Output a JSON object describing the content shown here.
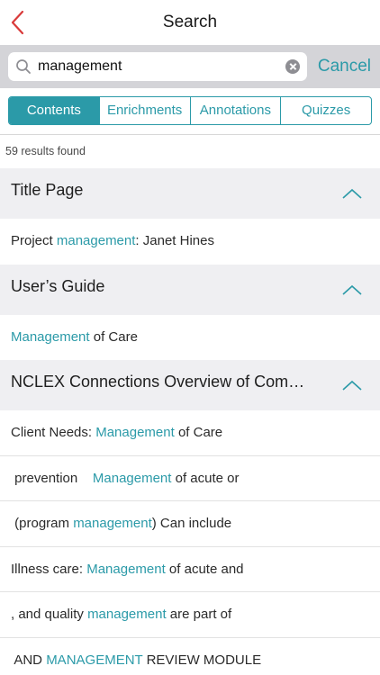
{
  "nav": {
    "title": "Search"
  },
  "search": {
    "query": "management",
    "cancel_label": "Cancel"
  },
  "tabs": [
    {
      "label": "Contents",
      "active": true
    },
    {
      "label": "Enrichments",
      "active": false
    },
    {
      "label": "Annotations",
      "active": false
    },
    {
      "label": "Quizzes",
      "active": false
    }
  ],
  "results_count": "59 results found",
  "colors": {
    "accent": "#2b9aa8",
    "header_bg": "#efeff2",
    "search_bar_bg": "#d4d4d8",
    "back_arrow": "#d93a3a"
  },
  "sections": [
    {
      "title": "Title Page",
      "rows": [
        {
          "before": "Project ",
          "match": "management",
          "after": ": Janet Hines"
        }
      ]
    },
    {
      "title": "User’s Guide",
      "rows": [
        {
          "before": "",
          "match": "Management",
          "after": " of Care"
        }
      ]
    },
    {
      "title": "NCLEX Connections Overview of Com…",
      "rows": [
        {
          "before": "Client Needs: ",
          "match": "Management",
          "after": " of Care"
        },
        {
          "before": " prevention    ",
          "match": "Management",
          "after": " of acute or"
        },
        {
          "before": " (program ",
          "match": "management",
          "after": ") Can include"
        },
        {
          "before": "Illness care: ",
          "match": "Management",
          "after": " of acute and"
        },
        {
          "before": ", and quality ",
          "match": "management",
          "after": " are part of"
        },
        {
          "before": " AND ",
          "match": "MANAGEMENT",
          "after": " REVIEW MODULE"
        }
      ]
    }
  ]
}
